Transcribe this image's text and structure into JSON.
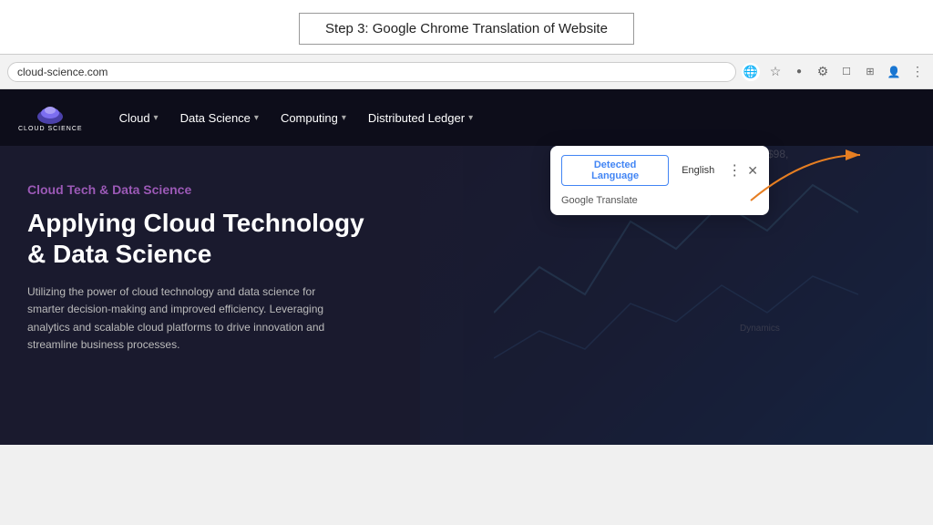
{
  "step_label": "Step 3: Google Chrome Translation of Website",
  "browser": {
    "url": "cloud-science.com",
    "icons": [
      "🌐",
      "☆",
      "●",
      "⚙",
      "☐",
      "⊞",
      "👤",
      "⋮"
    ]
  },
  "nav": {
    "logo_text": "CLOUD SCIENCE",
    "items": [
      {
        "label": "Cloud",
        "has_chevron": true
      },
      {
        "label": "Data Science",
        "has_chevron": true
      },
      {
        "label": "Computing",
        "has_chevron": true
      },
      {
        "label": "Distributed Ledger",
        "has_chevron": true
      }
    ]
  },
  "hero": {
    "subtitle": "Cloud Tech & Data Science",
    "title": "Applying Cloud Technology & Data Science",
    "description": "Utilizing the power of cloud technology and data science for smarter decision-making and improved efficiency. Leveraging analytics and scalable cloud platforms to drive innovation and streamline business processes."
  },
  "translate_popup": {
    "detected_label": "Detected Language",
    "english_label": "English",
    "google_translate_label": "Google Translate"
  }
}
